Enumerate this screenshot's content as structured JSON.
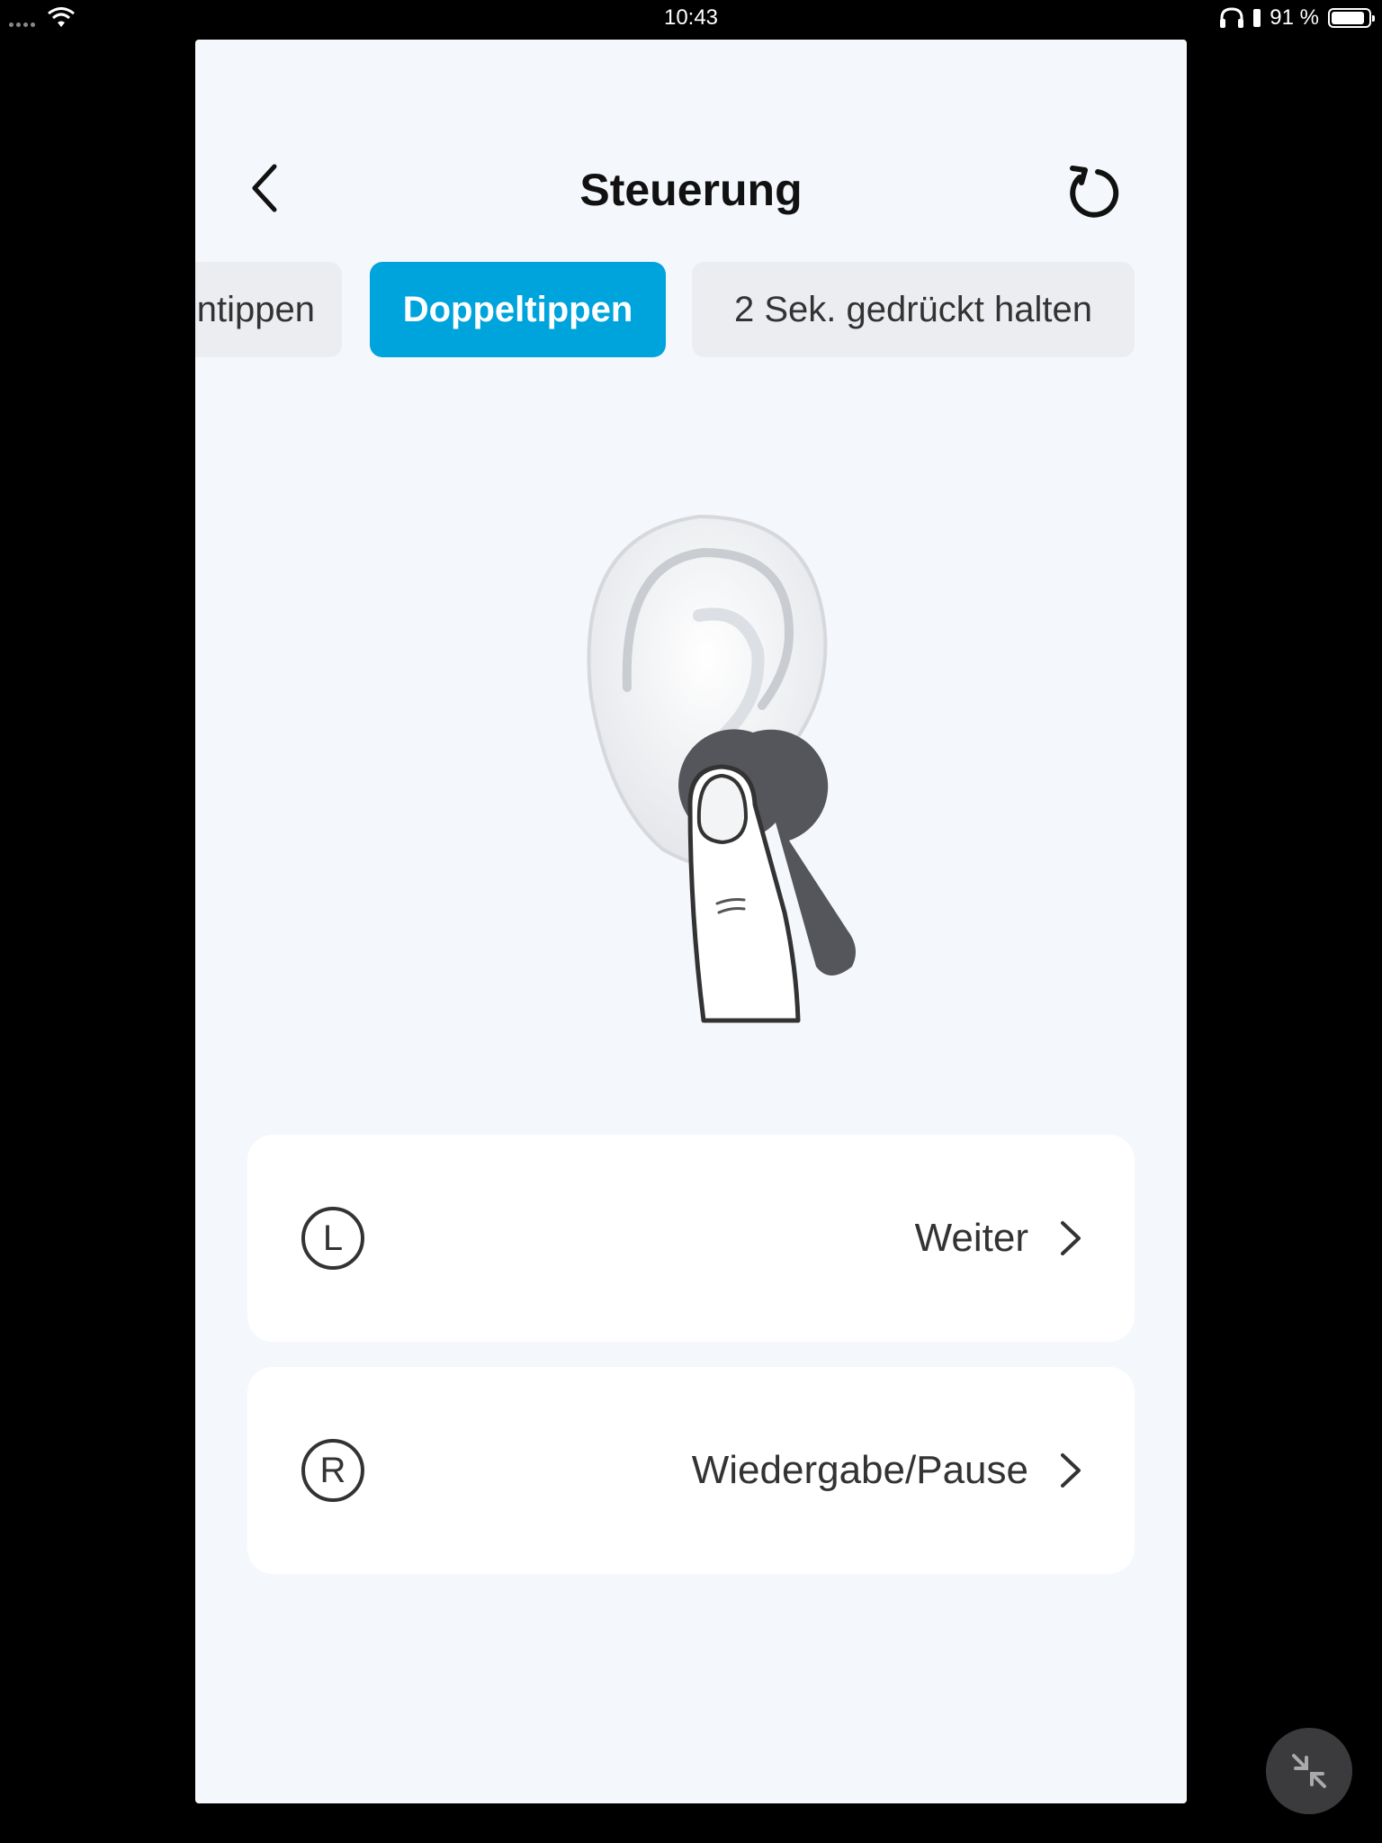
{
  "status_bar": {
    "time": "10:43",
    "battery": "91 %",
    "battery_level": 0.91
  },
  "nav": {
    "title": "Steuerung"
  },
  "tabs": [
    {
      "label": "Einmal antippen",
      "visible_label": "ntippen",
      "selected": false
    },
    {
      "label": "Doppeltippen",
      "selected": true
    },
    {
      "label": "2 Sek. gedrückt halten",
      "selected": false
    }
  ],
  "controls": [
    {
      "side": "L",
      "action": "Weiter"
    },
    {
      "side": "R",
      "action": "Wiedergabe/Pause"
    }
  ],
  "colors": {
    "accent": "#00a4dc",
    "panel_bg": "#f4f7fb",
    "earbud": "#55565c"
  }
}
